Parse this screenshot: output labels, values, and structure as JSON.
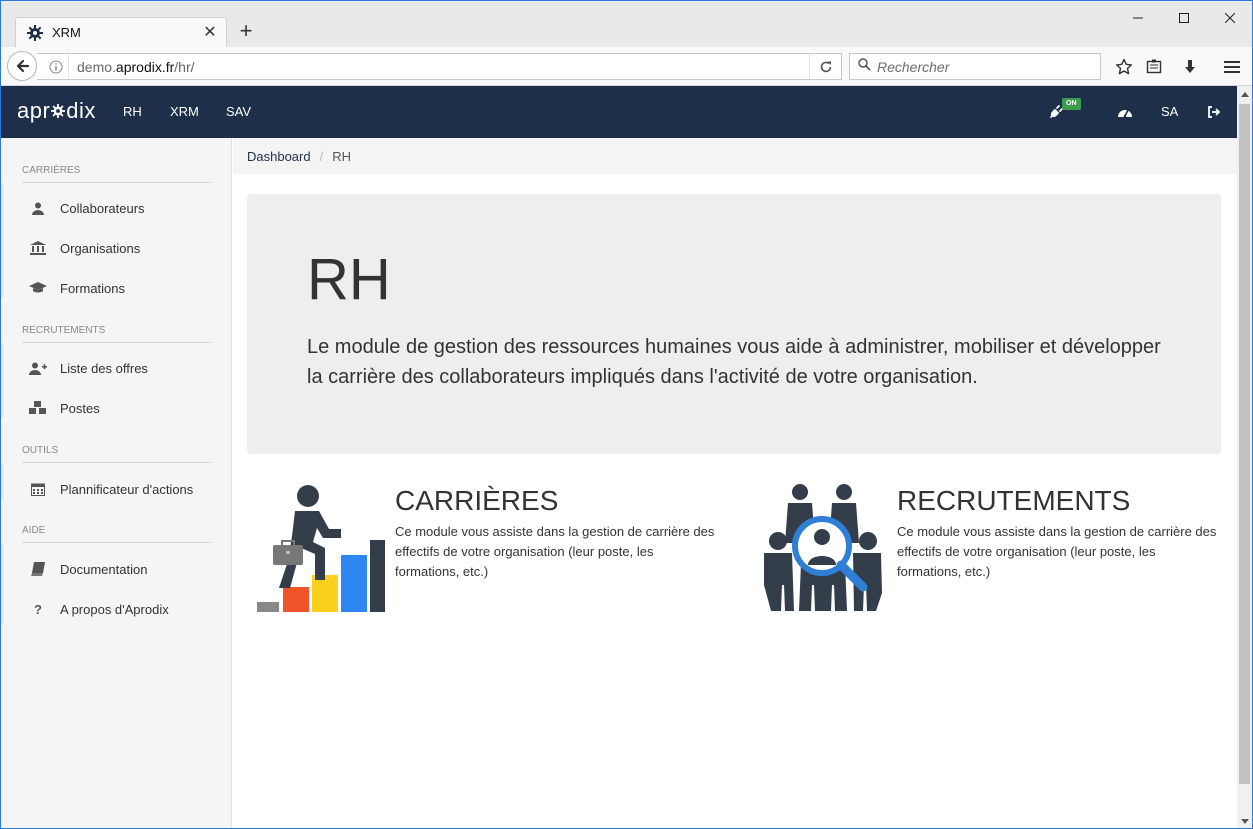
{
  "browser": {
    "tab_title": "XRM",
    "tab_close": "✕",
    "new_tab": "+",
    "url_prefix": "demo.",
    "url_domain": "aprodix.fr",
    "url_path": "/hr/",
    "search_placeholder": "Rechercher",
    "accent": "#2b79d9"
  },
  "header": {
    "brand_left": "apr",
    "brand_right": "dix",
    "nav": [
      "RH",
      "XRM",
      "SAV"
    ],
    "on_badge": "ON",
    "user": "SA",
    "bg_color": "#1e3049"
  },
  "sidebar": {
    "sections": [
      {
        "title": "CARRIÈRES",
        "items": [
          {
            "label": "Collaborateurs",
            "icon": "user-icon"
          },
          {
            "label": "Organisations",
            "icon": "bank-icon"
          },
          {
            "label": "Formations",
            "icon": "graduation-cap-icon"
          }
        ]
      },
      {
        "title": "RECRUTEMENTS",
        "items": [
          {
            "label": "Liste des offres",
            "icon": "user-plus-icon"
          },
          {
            "label": "Postes",
            "icon": "cubes-icon"
          }
        ]
      },
      {
        "title": "OUTILS",
        "items": [
          {
            "label": "Plannificateur d'actions",
            "icon": "calendar-icon"
          }
        ]
      },
      {
        "title": "AIDE",
        "items": [
          {
            "label": "Documentation",
            "icon": "book-icon"
          },
          {
            "label": "A propos d'Aprodix",
            "icon": "question-icon"
          }
        ]
      }
    ]
  },
  "breadcrumb": {
    "home": "Dashboard",
    "separator": "/",
    "current": "RH"
  },
  "jumbotron": {
    "title": "RH",
    "text": "Le module de gestion des ressources humaines vous aide à administrer, mobiliser et développer la carrière des collaborateurs impliqués dans l'activité de votre organisation."
  },
  "modules": [
    {
      "title": "CARRIÈRES",
      "description": "Ce module vous assiste dans la gestion de carrière des effectifs de votre organisation (leur poste, les formations, etc.)",
      "icon": "career-stairs-icon"
    },
    {
      "title": "RECRUTEMENTS",
      "description": "Ce module vous assiste dans la gestion de carrière des effectifs de votre organisation (leur poste, les formations, etc.)",
      "icon": "recruitment-search-icon"
    }
  ]
}
